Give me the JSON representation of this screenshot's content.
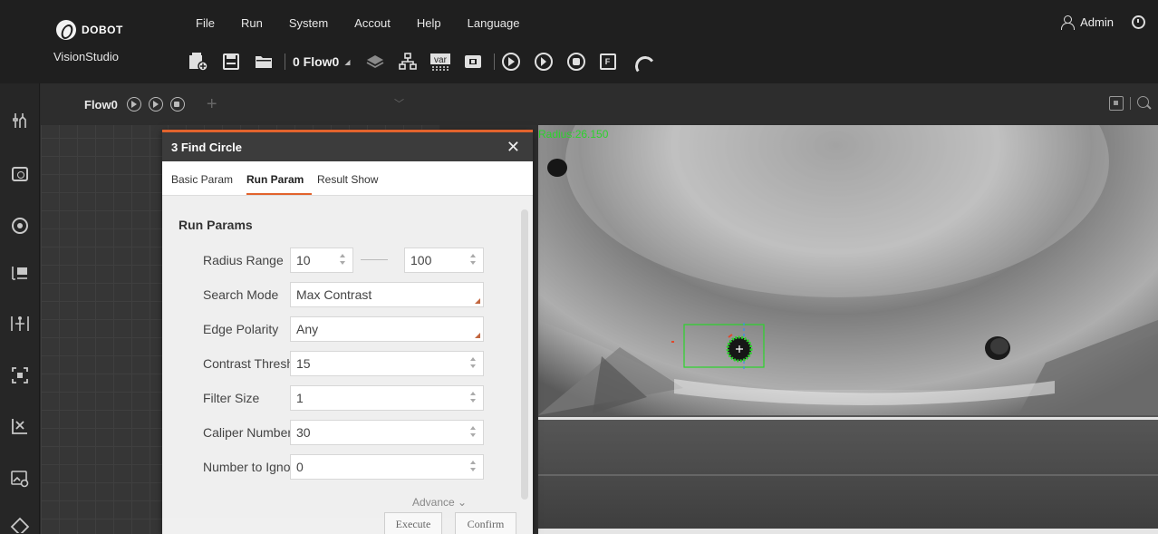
{
  "app": {
    "brand": "DOBOT",
    "name": "VisionStudio"
  },
  "menu": [
    "File",
    "Run",
    "System",
    "Accout",
    "Help",
    "Language"
  ],
  "user": {
    "name": "Admin"
  },
  "toolbar": {
    "flow_selected": "0 Flow0",
    "icons": [
      "new-solution-icon",
      "save-icon",
      "open-folder-icon",
      "flow-select",
      "layers-icon",
      "network-icon",
      "variable-icon",
      "communication-icon",
      "run-once-icon",
      "run-loop-icon",
      "stop-icon",
      "formula-icon",
      "camera-arm-icon"
    ],
    "var_label": "var",
    "f_label": "F"
  },
  "flow_panel": {
    "tab": "Flow0"
  },
  "viewer": {
    "radius_readout": "Radius:26.150"
  },
  "dialog": {
    "title": "3 Find Circle",
    "tabs": [
      "Basic Param",
      "Run Param",
      "Result Show"
    ],
    "active_tab": "Run Param",
    "section": "Run Params",
    "params": {
      "radius_range": {
        "label": "Radius Range",
        "min": "10",
        "max": "100"
      },
      "search_mode": {
        "label": "Search Mode",
        "value": "Max Contrast"
      },
      "edge_polarity": {
        "label": "Edge Polarity",
        "value": "Any"
      },
      "contrast_threshold": {
        "label": "Contrast Threshold",
        "value": "15"
      },
      "filter_size": {
        "label": "Filter Size",
        "value": "1"
      },
      "caliper_number": {
        "label": "Caliper Number",
        "value": "30"
      },
      "number_to_ignore": {
        "label": "Number to Ignore",
        "value": "0"
      }
    },
    "advance": "Advance ⌄",
    "execute": "Execute",
    "confirm": "Confirm"
  },
  "colors": {
    "accent": "#e2632d",
    "overlay_green": "#2bd42b",
    "overlay_blue": "#3a8df0"
  }
}
